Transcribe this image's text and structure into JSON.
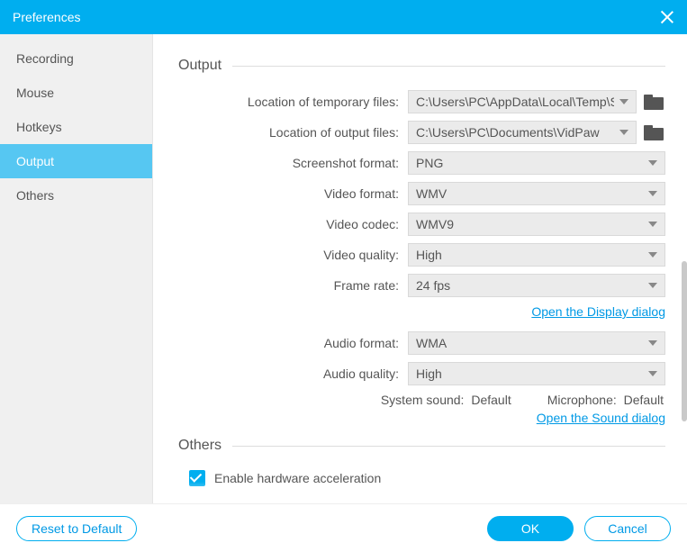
{
  "window": {
    "title": "Preferences"
  },
  "sidebar": {
    "items": [
      {
        "label": "Recording"
      },
      {
        "label": "Mouse"
      },
      {
        "label": "Hotkeys"
      },
      {
        "label": "Output"
      },
      {
        "label": "Others"
      }
    ],
    "active_index": 3
  },
  "sections": {
    "output": {
      "title": "Output"
    },
    "others": {
      "title": "Others"
    }
  },
  "fields": {
    "temp_location": {
      "label": "Location of temporary files:",
      "value": "C:\\Users\\PC\\AppData\\Local\\Temp\\ScreenRecorder"
    },
    "output_location": {
      "label": "Location of output files:",
      "value": "C:\\Users\\PC\\Documents\\VidPaw"
    },
    "screenshot_format": {
      "label": "Screenshot format:",
      "value": "PNG"
    },
    "video_format": {
      "label": "Video format:",
      "value": "WMV"
    },
    "video_codec": {
      "label": "Video codec:",
      "value": "WMV9"
    },
    "video_quality": {
      "label": "Video quality:",
      "value": "High"
    },
    "frame_rate": {
      "label": "Frame rate:",
      "value": "24 fps"
    },
    "audio_format": {
      "label": "Audio format:",
      "value": "WMA"
    },
    "audio_quality": {
      "label": "Audio quality:",
      "value": "High"
    },
    "system_sound": {
      "label": "System sound:",
      "value": "Default"
    },
    "microphone": {
      "label": "Microphone:",
      "value": "Default"
    }
  },
  "links": {
    "display": "Open the Display dialog",
    "sound": "Open the Sound dialog"
  },
  "checkbox": {
    "hw_accel": {
      "label": "Enable hardware acceleration",
      "checked": true
    }
  },
  "footer": {
    "reset": "Reset to Default",
    "ok": "OK",
    "cancel": "Cancel"
  }
}
